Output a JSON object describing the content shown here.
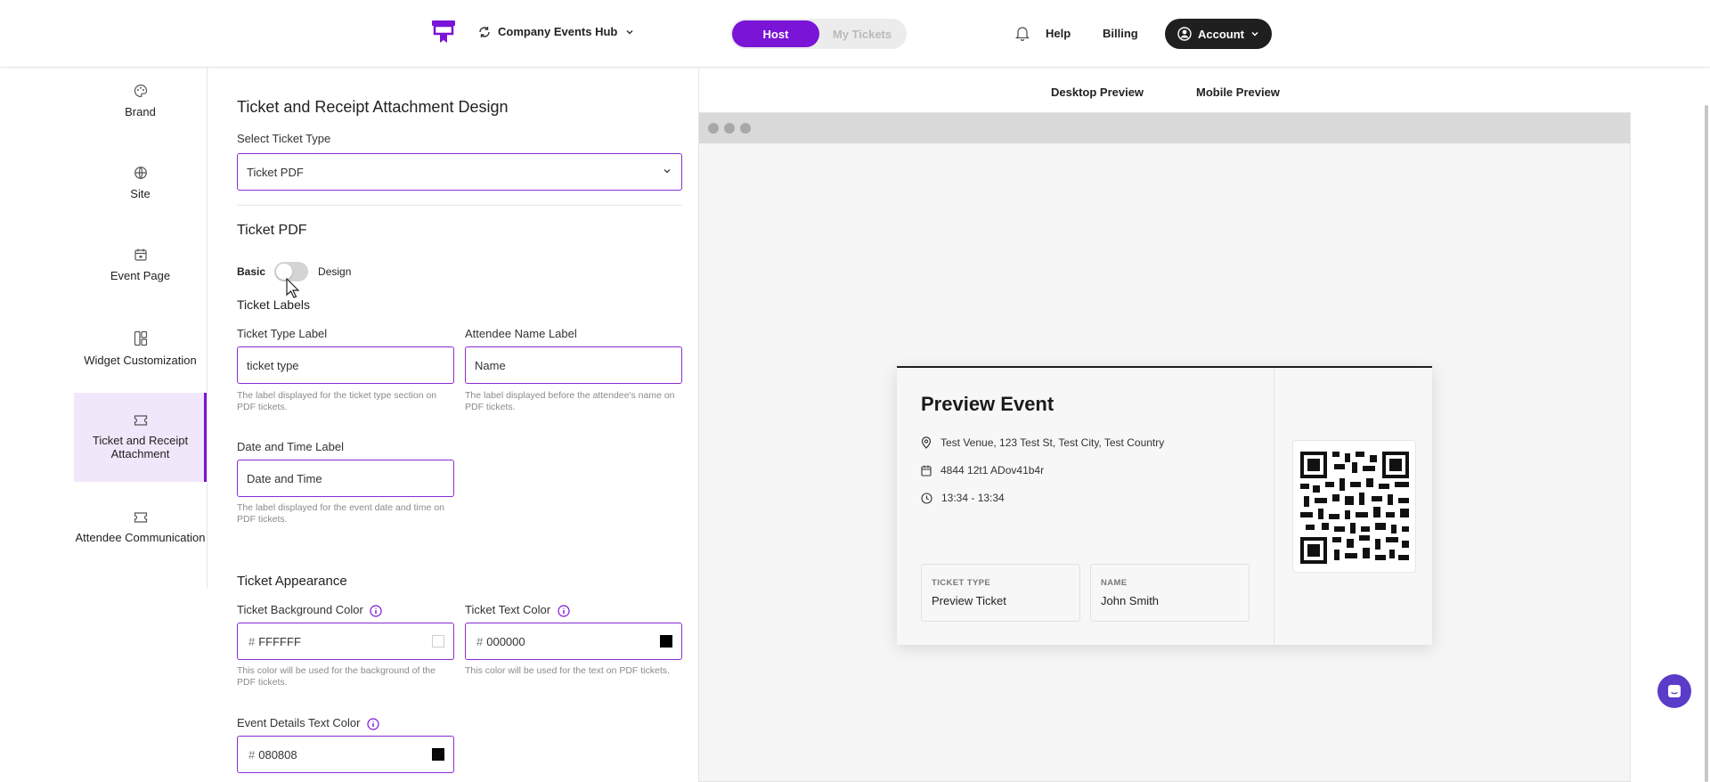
{
  "topbar": {
    "hub_name": "Company Events Hub",
    "segment": {
      "host": "Host",
      "my_tickets": "My Tickets"
    },
    "help": "Help",
    "billing": "Billing",
    "account": "Account",
    "accent_color": "#7a14d6"
  },
  "sidebar": {
    "items": [
      {
        "label": "Brand",
        "icon": "palette-icon"
      },
      {
        "label": "Site",
        "icon": "globe-icon"
      },
      {
        "label": "Event Page",
        "icon": "calendar-icon"
      },
      {
        "label": "Widget Customization",
        "icon": "layout-icon"
      },
      {
        "label": "Ticket and Receipt Attachment",
        "icon": "ticket-icon",
        "active": true
      },
      {
        "label": "Attendee Communication",
        "icon": "ticket-icon"
      }
    ]
  },
  "form": {
    "title": "Ticket and Receipt Attachment Design",
    "select_label": "Select Ticket Type",
    "select_value": "Ticket PDF",
    "section_title": "Ticket PDF",
    "toggle": {
      "left": "Basic",
      "right": "Design",
      "on": false
    },
    "labels_title": "Ticket Labels",
    "ticket_type_label": {
      "label": "Ticket Type Label",
      "value": "ticket type",
      "help": "The label displayed for the ticket type section on PDF tickets."
    },
    "attendee_name_label": {
      "label": "Attendee Name Label",
      "value": "Name",
      "help": "The label displayed before the attendee's name on PDF tickets."
    },
    "date_time_label": {
      "label": "Date and Time Label",
      "value": "Date and Time",
      "help": "The label displayed for the event date and time on PDF tickets."
    },
    "appearance_title": "Ticket Appearance",
    "bg_color": {
      "label": "Ticket Background Color",
      "value": "FFFFFF",
      "help": "This color will be used for the background of the PDF tickets.",
      "swatch": "#FFFFFF"
    },
    "text_color": {
      "label": "Ticket Text Color",
      "value": "000000",
      "help": "This color will be used for the text on PDF tickets.",
      "swatch": "#000000"
    },
    "details_color": {
      "label": "Event Details Text Color",
      "value": "080808",
      "swatch": "#080808"
    }
  },
  "preview": {
    "tabs": {
      "desktop": "Desktop Preview",
      "mobile": "Mobile Preview"
    },
    "ticket": {
      "title": "Preview Event",
      "venue": "Test Venue, 123 Test St, Test City, Test Country",
      "date": "4844 12t1 ADov41b4r",
      "time": "13:34 - 13:34",
      "type_key": "TICKET TYPE",
      "type_value": "Preview Ticket",
      "name_key": "NAME",
      "name_value": "John Smith"
    }
  }
}
